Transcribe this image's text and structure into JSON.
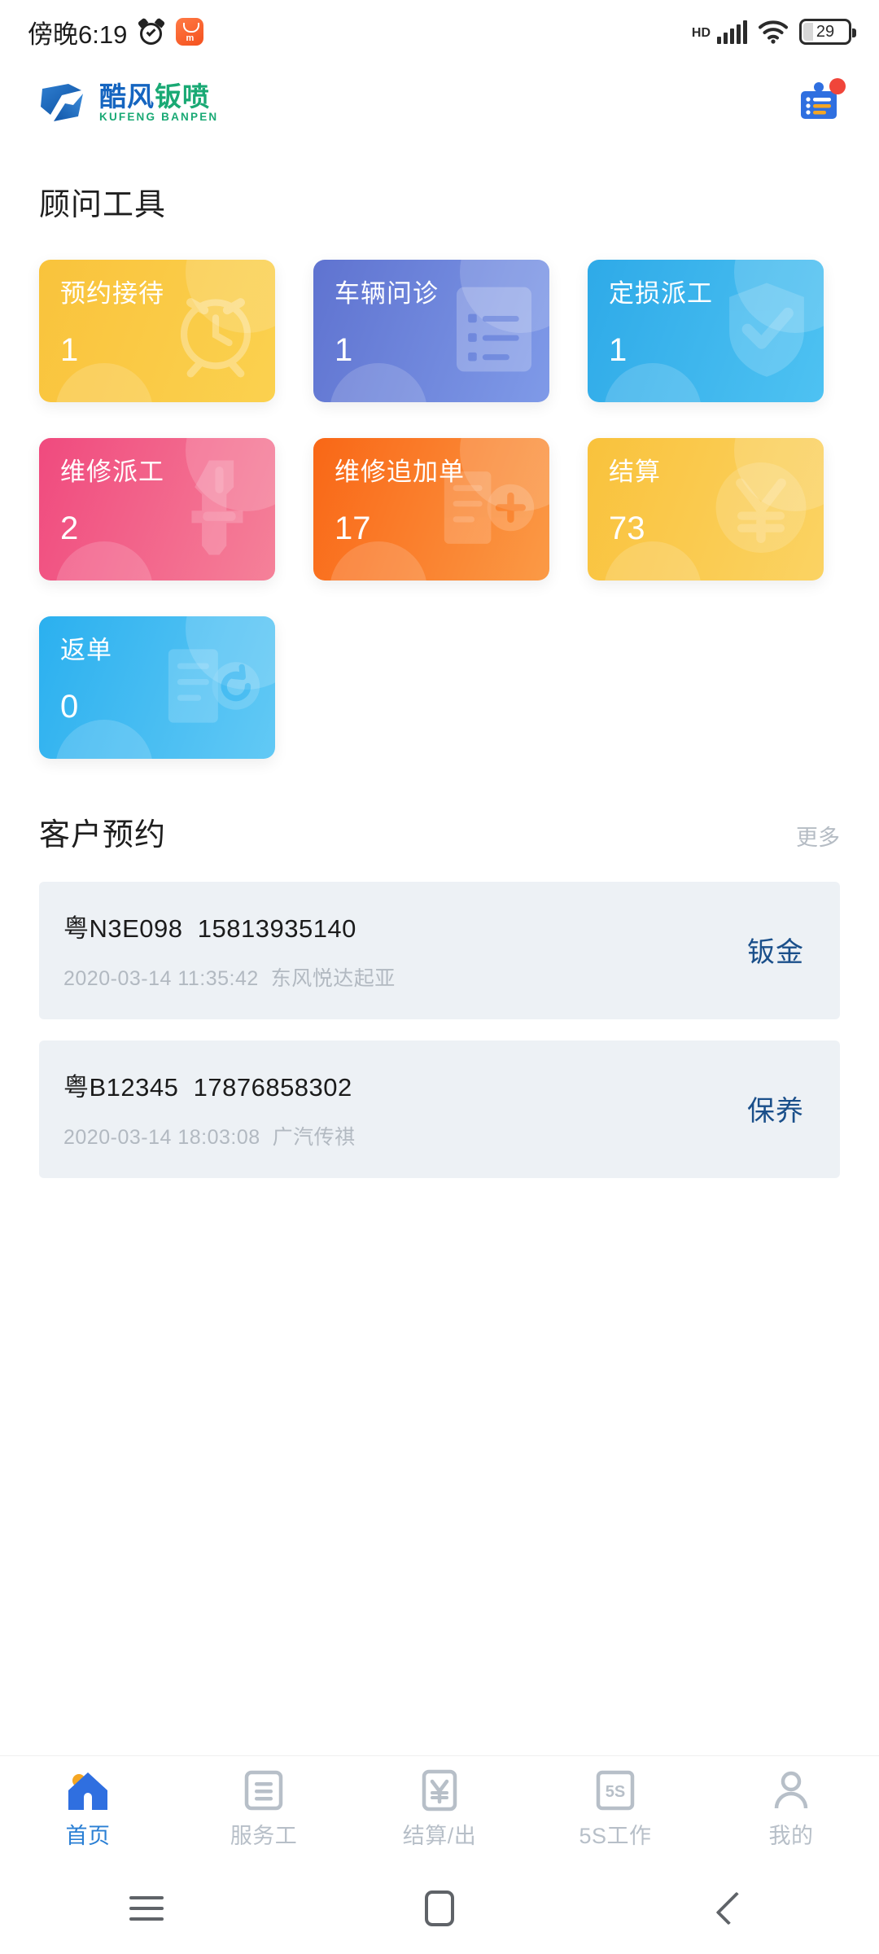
{
  "status_bar": {
    "time": "傍晚6:19",
    "alarm_icon": "alarm-clock-icon",
    "app_icon": "xiaomi-store-icon",
    "hd_label": "HD",
    "signal_icon": "cellular-signal-icon",
    "wifi_icon": "wifi-icon",
    "battery_percent": "29"
  },
  "app_header": {
    "logo_cn_blue": "酷风",
    "logo_cn_green": "钣喷",
    "logo_en": "KUFENG BANPEN",
    "logo_mark_icon": "kufeng-logo-mark-icon",
    "notification_icon": "task-board-icon",
    "has_notification_dot": true
  },
  "tools_section": {
    "title": "顾问工具",
    "cards": [
      {
        "label": "预约接待",
        "value": "1",
        "icon": "alarm-clock-icon",
        "from": "#f9c33c",
        "to": "#fbd14f"
      },
      {
        "label": "车辆问诊",
        "value": "1",
        "icon": "checklist-icon",
        "from": "#5f73d0",
        "to": "#7f9ae8"
      },
      {
        "label": "定损派工",
        "value": "1",
        "icon": "shield-check-icon",
        "from": "#2eaae8",
        "to": "#4ec2f2"
      },
      {
        "label": "维修派工",
        "value": "2",
        "icon": "wrench-icon",
        "from": "#f04a7e",
        "to": "#f58199"
      },
      {
        "label": "维修追加单",
        "value": "17",
        "icon": "invoice-plus-icon",
        "from": "#f96716",
        "to": "#fb9a46"
      },
      {
        "label": "结算",
        "value": "73",
        "icon": "yuan-coin-icon",
        "from": "#f9c23c",
        "to": "#fbd363"
      },
      {
        "label": "返单",
        "value": "0",
        "icon": "invoice-return-icon",
        "from": "#2bb0ef",
        "to": "#62c9f5"
      }
    ]
  },
  "appointments_section": {
    "title": "客户预约",
    "more_label": "更多",
    "items": [
      {
        "plate": "粤N3E098",
        "phone": "15813935140",
        "datetime": "2020-03-14 11:35:42",
        "brand": "东风悦达起亚",
        "tag": "钣金"
      },
      {
        "plate": "粤B12345",
        "phone": "17876858302",
        "datetime": "2020-03-14 18:03:08",
        "brand": "广汽传祺",
        "tag": "保养"
      }
    ]
  },
  "tab_bar": {
    "active_color": "#2a7fd4",
    "inactive_color": "#b7bfc8",
    "items": [
      {
        "label": "首页",
        "icon": "home-icon",
        "active": true
      },
      {
        "label": "服务工",
        "icon": "document-icon",
        "active": false
      },
      {
        "label": "结算/出",
        "icon": "yuan-note-icon",
        "active": false
      },
      {
        "label": "5S工作",
        "icon": "five-s-icon",
        "active": false
      },
      {
        "label": "我的",
        "icon": "person-icon",
        "active": false
      }
    ]
  },
  "system_nav": {
    "recents_icon": "menu-icon",
    "home_icon": "square-icon",
    "back_icon": "back-chevron-icon"
  }
}
